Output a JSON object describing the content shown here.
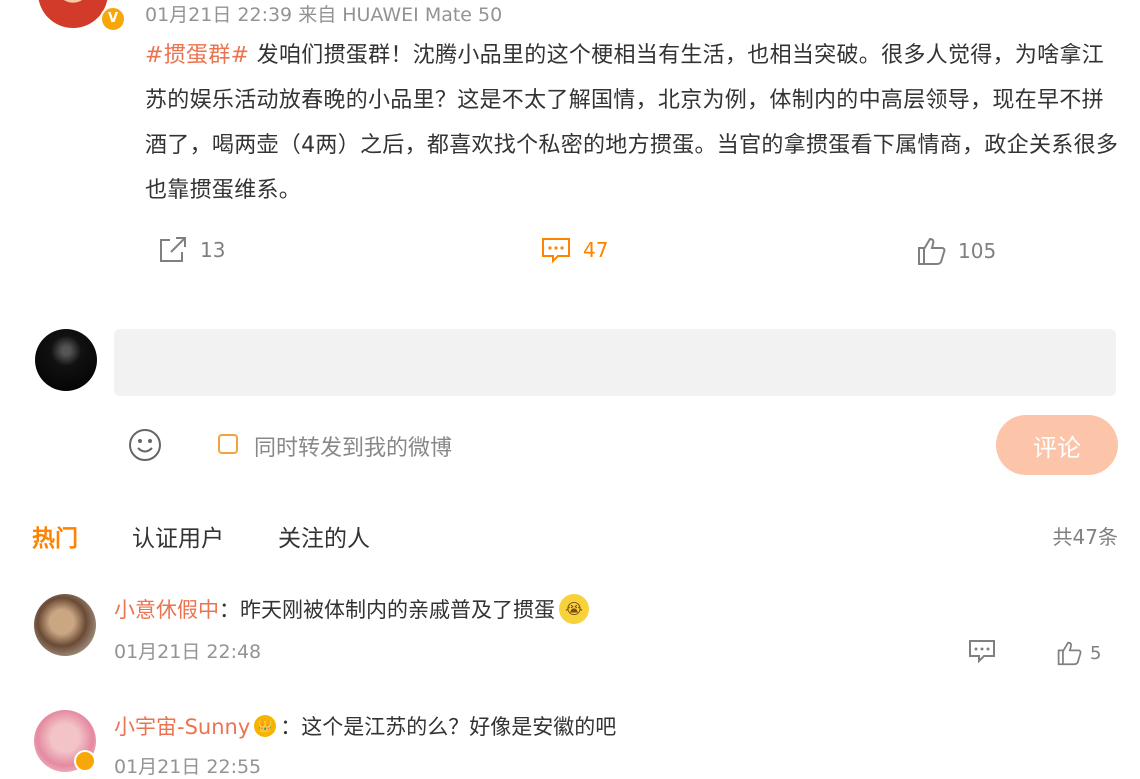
{
  "post": {
    "meta": "01月21日 22:39  来自 HUAWEI Mate 50",
    "badge": "V",
    "tag": "#掼蛋群#",
    "text": " 发咱们掼蛋群！沈腾小品里的这个梗相当有生活，也相当突破。很多人觉得，为啥拿江苏的娱乐活动放春晚的小品里？这是不太了解国情，北京为例，体制内的中高层领导，现在早不拼酒了，喝两壶（4两）之后，都喜欢找个私密的地方掼蛋。当官的拿掼蛋看下属情商，政企关系很多也靠掼蛋维系。",
    "actions": {
      "share_count": "13",
      "comment_count": "47",
      "like_count": "105"
    }
  },
  "composer": {
    "input_value": "",
    "repost_label": "同时转发到我的微博",
    "submit_label": "评论"
  },
  "comments_section": {
    "tabs": [
      "热门",
      "认证用户",
      "关注的人"
    ],
    "total": "共47条",
    "comments": [
      {
        "name": "小意休假中",
        "separator": "：",
        "text": "昨天刚被体制内的亲戚普及了掼蛋",
        "emoji_glyph": "😭",
        "time": "01月21日 22:48",
        "likes": "5"
      },
      {
        "name": "小宇宙-Sunny",
        "separator": "：",
        "text": "这个是江苏的么？好像是安徽的吧",
        "emoji_glyph": "👑",
        "time": "01月21日 22:55",
        "likes": ""
      }
    ]
  },
  "colors": {
    "accent": "#ff8200",
    "link": "#eb7350",
    "submit_disabled": "#fcc4a8"
  }
}
